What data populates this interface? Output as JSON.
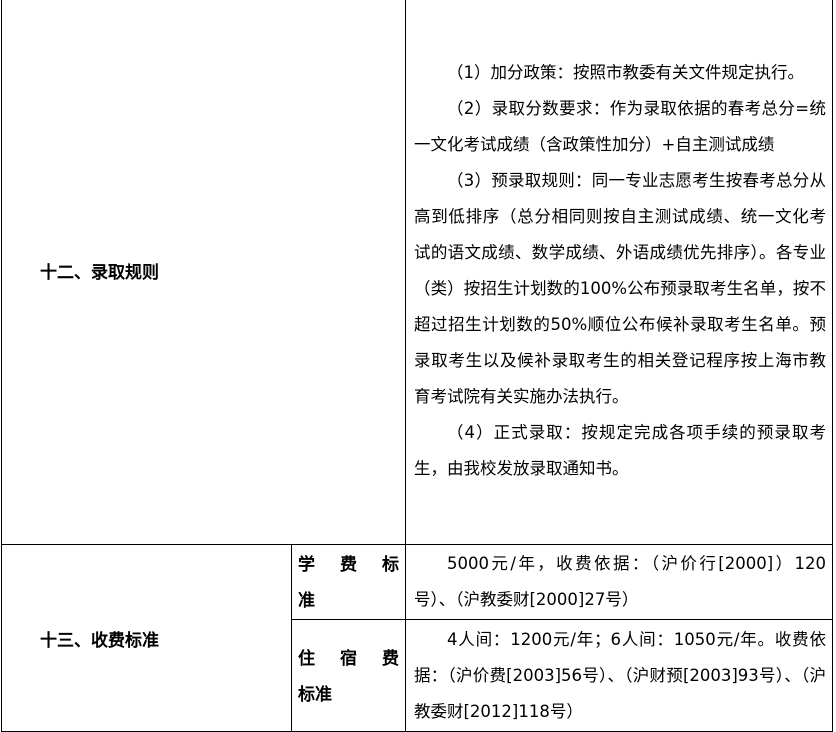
{
  "section12": {
    "label": "十二、录取规则",
    "paragraphs": [
      "（1）加分政策：按照市教委有关文件规定执行。",
      "（2）录取分数要求：作为录取依据的春考总分=统一文化考试成绩（含政策性加分）+自主测试成绩",
      "（3）预录取规则：同一专业志愿考生按春考总分从高到低排序（总分相同则按自主测试成绩、统一文化考试的语文成绩、数学成绩、外语成绩优先排序）。各专业（类）按招生计划数的100%公布预录取考生名单，按不超过招生计划数的50%顺位公布候补录取考生名单。预录取考生以及候补录取考生的相关登记程序按上海市教育考试院有关实施办法执行。",
      "（4）正式录取：按规定完成各项手续的预录取考生，由我校发放录取通知书。"
    ]
  },
  "section13": {
    "label": "十三、收费标准",
    "tuition": {
      "label_first": "学费标",
      "label_second": "准",
      "text": "5000元/年，收费依据：（沪价行[2000]）120号）、（沪教委财[2000]27号）"
    },
    "housing": {
      "label_first": "住宿费",
      "label_second": "标准",
      "text": "4人间：1200元/年；6人间：1050元/年。收费依据：（沪价费[2003]56号）、（沪财预[2003]93号）、（沪教委财[2012]118号）"
    }
  }
}
